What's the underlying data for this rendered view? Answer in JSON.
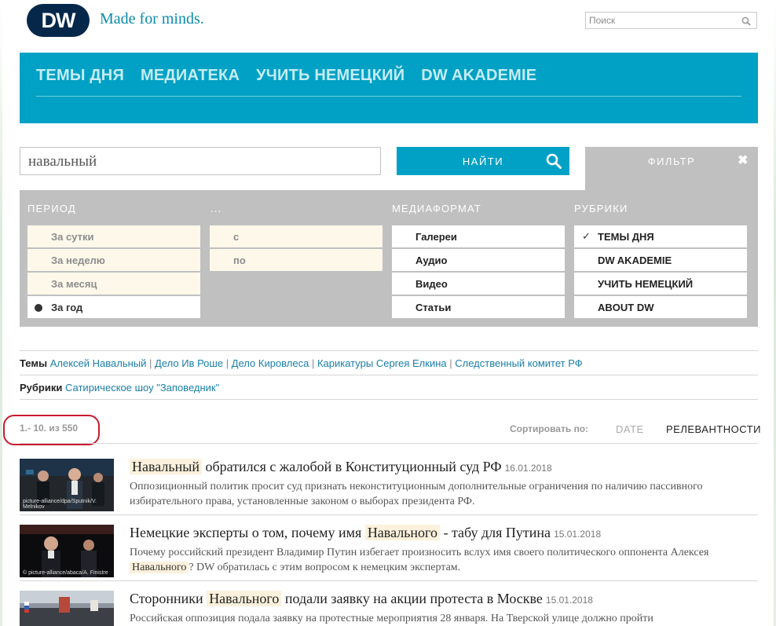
{
  "header": {
    "logo": "DW",
    "tagline": "Made for minds.",
    "search_placeholder": "Поиск"
  },
  "nav": [
    "ТЕМЫ ДНЯ",
    "МЕДИАТЕКА",
    "УЧИТЬ НЕМЕЦКИЙ",
    "DW AKADEMIE"
  ],
  "search": {
    "query": "навальный",
    "button": "НАЙТИ",
    "filter": "ФИЛЬТР",
    "close": "✖"
  },
  "filters": {
    "period": {
      "heading": "ПЕРИОД",
      "options": [
        "За сутки",
        "За неделю",
        "За месяц",
        "За год"
      ],
      "selected": "За год"
    },
    "range": {
      "heading": "...",
      "from": "с",
      "to": "по"
    },
    "format": {
      "heading": "МЕДИАФОРМАТ",
      "options": [
        "Галереи",
        "Аудио",
        "Видео",
        "Статьи"
      ]
    },
    "rubrics": {
      "heading": "РУБРИКИ",
      "options": [
        "ТЕМЫ ДНЯ",
        "DW AKADEMIE",
        "УЧИТЬ НЕМЕЦКИЙ",
        "ABOUT DW"
      ],
      "checked": "ТЕМЫ ДНЯ"
    }
  },
  "topics": {
    "label": "Темы",
    "links": [
      "Алексей Навальный",
      "Дело Ив Роше",
      "Дело Кировлеса",
      "Карикатуры Сергея Елкина",
      "Следственный комитет РФ"
    ]
  },
  "rubric_links": {
    "label": "Рубрики",
    "links": [
      "Сатирическое шоу \"Заповедник\""
    ]
  },
  "results_meta": {
    "count": "1.- 10. из 550",
    "sort_label": "Сортировать по:",
    "sort_date": "DATE",
    "sort_relevance": "РЕЛЕВАНТНОСТИ"
  },
  "results": [
    {
      "title_hl": "Навальный",
      "title_rest": "обратился с жалобой в Конституционный суд РФ",
      "date": "16.01.2018",
      "desc": "Оппозиционный политик просит суд признать неконституционным дополнительные ограничения по наличию пассивного избирательного права, установленные законом о выборах президента РФ.",
      "credit": "picture-alliance/dpa/Sputnik/V. Melnikov"
    },
    {
      "title_pre": "Немецкие эксперты о том, почему имя",
      "title_hl": "Навального",
      "title_post": "- табу для Путина",
      "date": "15.01.2018",
      "desc_pre": "Почему российский президент Владимир Путин избегает произносить вслух имя своего политического оппонента Алексея",
      "desc_hl": "Навального",
      "desc_post": "? DW обратилась с этим вопросом к немецким экспертам.",
      "credit": "© picture-alliance/abaca/A. Finistre"
    },
    {
      "title_pre": "Сторонники",
      "title_hl": "Навального",
      "title_post": "подали заявку на акции протеста в Москве",
      "date": "15.01.2018",
      "desc": "Российская оппозиция подала заявку на протестные мероприятия 28 января. На Тверской улице должно пройти"
    }
  ]
}
